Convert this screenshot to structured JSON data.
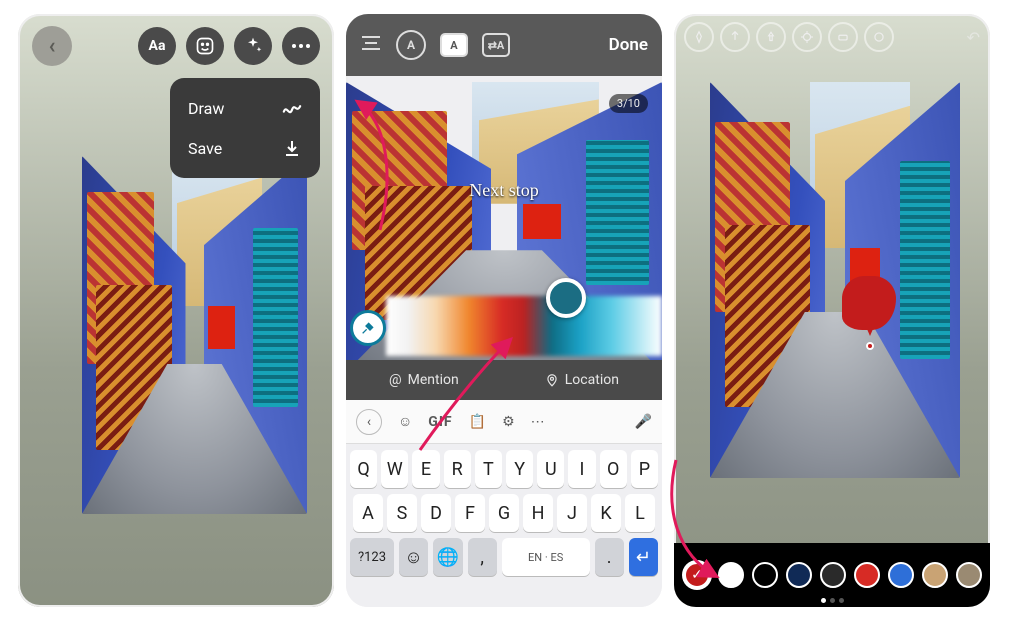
{
  "colors": {
    "accent_red": "#e01a5b",
    "dropdown_bg": "#3a3a3a",
    "balloon": "#c31c1c"
  },
  "screen1": {
    "back_glyph": "‹",
    "tool_text": {
      "label": "Aa"
    },
    "dropdown": {
      "draw": "Draw",
      "save": "Save"
    }
  },
  "screen2": {
    "done_label": "Done",
    "counter": "3/10",
    "overlay_text": "Next stop",
    "mention_row": {
      "mention": "Mention",
      "location": "Location"
    },
    "keyboard": {
      "toolbar": {
        "gif": "GIF"
      },
      "row1": [
        "Q",
        "W",
        "E",
        "R",
        "T",
        "Y",
        "U",
        "I",
        "O",
        "P"
      ],
      "row2": [
        "A",
        "S",
        "D",
        "F",
        "G",
        "H",
        "J",
        "K",
        "L"
      ],
      "row_bottom": {
        "num": "?123",
        "lang": "EN · ES",
        "comma": ",",
        "period": "."
      }
    }
  },
  "screen3": {
    "swatches": [
      {
        "color": "#c31c1c",
        "selected": true,
        "check": true
      },
      {
        "color": "#ffffff"
      },
      {
        "color": "#000000"
      },
      {
        "color": "#102a56"
      },
      {
        "color": "#2a2a2a"
      },
      {
        "color": "#d72b25"
      },
      {
        "color": "#2e6fd8"
      },
      {
        "color": "#c9a374"
      },
      {
        "color": "#9a8a72"
      },
      {
        "color": "#0a4a2e"
      },
      {
        "color": "#c6822d"
      }
    ],
    "page_dots": {
      "count": 3,
      "active": 0
    }
  }
}
